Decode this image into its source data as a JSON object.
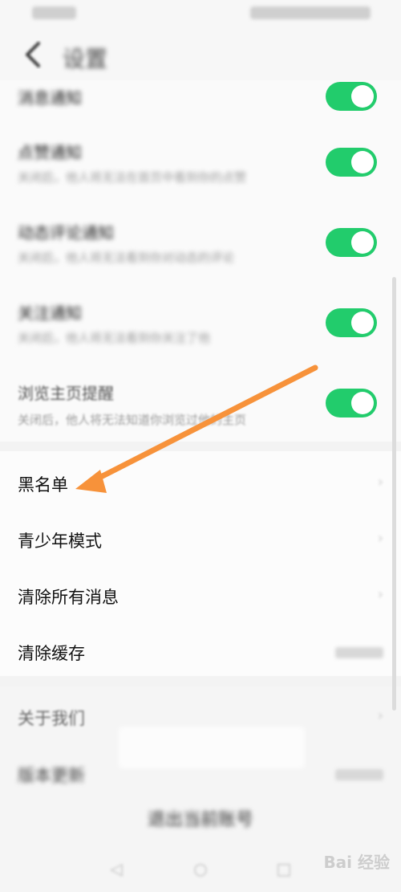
{
  "status_bar": {},
  "header": {
    "title": "设置",
    "back_icon": "back-chevron-icon"
  },
  "toggles": [
    {
      "title": "消息通知",
      "subtitle": "",
      "on": true
    },
    {
      "title": "点赞通知",
      "subtitle": "关闭后，他人将无法在首页中看到你的点赞",
      "on": true
    },
    {
      "title": "动态评论通知",
      "subtitle": "关闭后，他人将无法看到你对动态的评论",
      "on": true
    },
    {
      "title": "关注通知",
      "subtitle": "关闭后，他人将无法看到你关注了他",
      "on": true
    },
    {
      "title": "浏览主页提醒",
      "subtitle": "关闭后，他人将无法知道你浏览过他的主页",
      "on": true
    }
  ],
  "menu": [
    {
      "label": "黑名单",
      "chevron": "›"
    },
    {
      "label": "青少年模式",
      "chevron": "›"
    },
    {
      "label": "清除所有消息",
      "chevron": "›"
    },
    {
      "label": "清除缓存"
    }
  ],
  "about": [
    {
      "label": "关于我们",
      "chevron": "›"
    },
    {
      "label": "版本更新"
    }
  ],
  "logout_label": "退出当前账号",
  "nav": {
    "back": "◁",
    "home": "○",
    "recent": "□"
  },
  "watermark": "Bai 经验",
  "colors": {
    "toggle_on": "#22cc6c",
    "arrow": "#f7923a"
  }
}
